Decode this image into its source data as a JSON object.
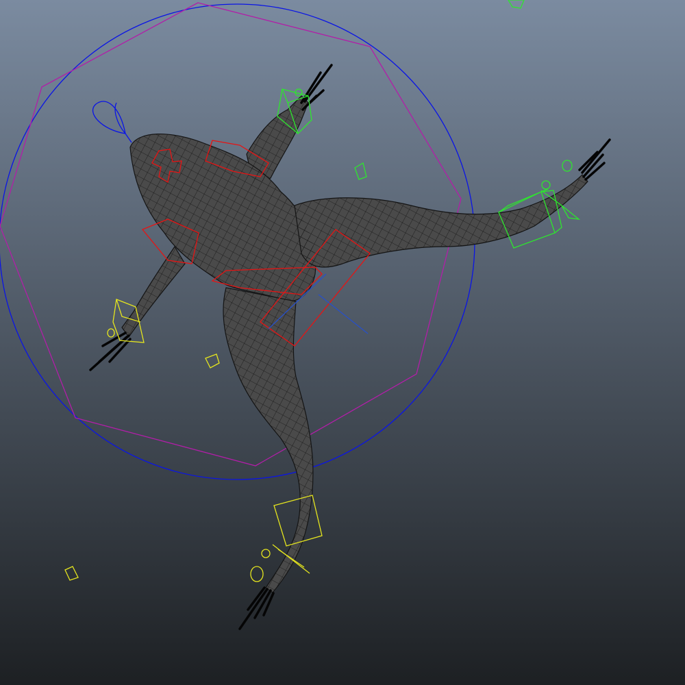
{
  "viewport": {
    "background_top": "#7b8ba0",
    "background_bottom": "#1d2023"
  },
  "colors": {
    "mesh_fill": "#4a4a4a",
    "mesh_wire": "#141414",
    "global_control": "#0a14e6",
    "world_control": "#b21ea8",
    "spine_control": "#e61414",
    "left_control": "#2ee62e",
    "right_control": "#e6e61e",
    "aim_vector": "#2850c8"
  },
  "icons": {
    "global_control": "circle-control-icon",
    "world_control": "octagon-control-icon",
    "ik_handle": "cube-control-icon",
    "pole_vector": "pole-vector-icon"
  }
}
